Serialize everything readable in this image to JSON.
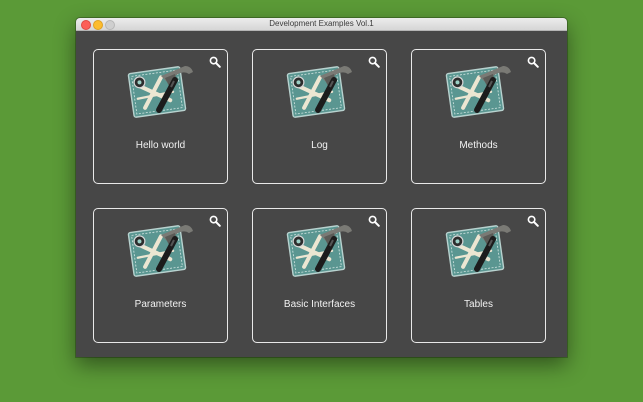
{
  "window": {
    "title": "Development Examples Vol.1"
  },
  "tiles": [
    {
      "label": "Hello world"
    },
    {
      "label": "Log"
    },
    {
      "label": "Methods"
    },
    {
      "label": "Parameters"
    },
    {
      "label": "Basic Interfaces"
    },
    {
      "label": "Tables"
    }
  ],
  "icons": {
    "tile_icon": "xcode-blueprint-hammer-icon",
    "tile_action": "magnifier-icon"
  },
  "colors": {
    "background": "#5b9a37",
    "window": "#474747",
    "tile_border": "#e9e9e9"
  }
}
